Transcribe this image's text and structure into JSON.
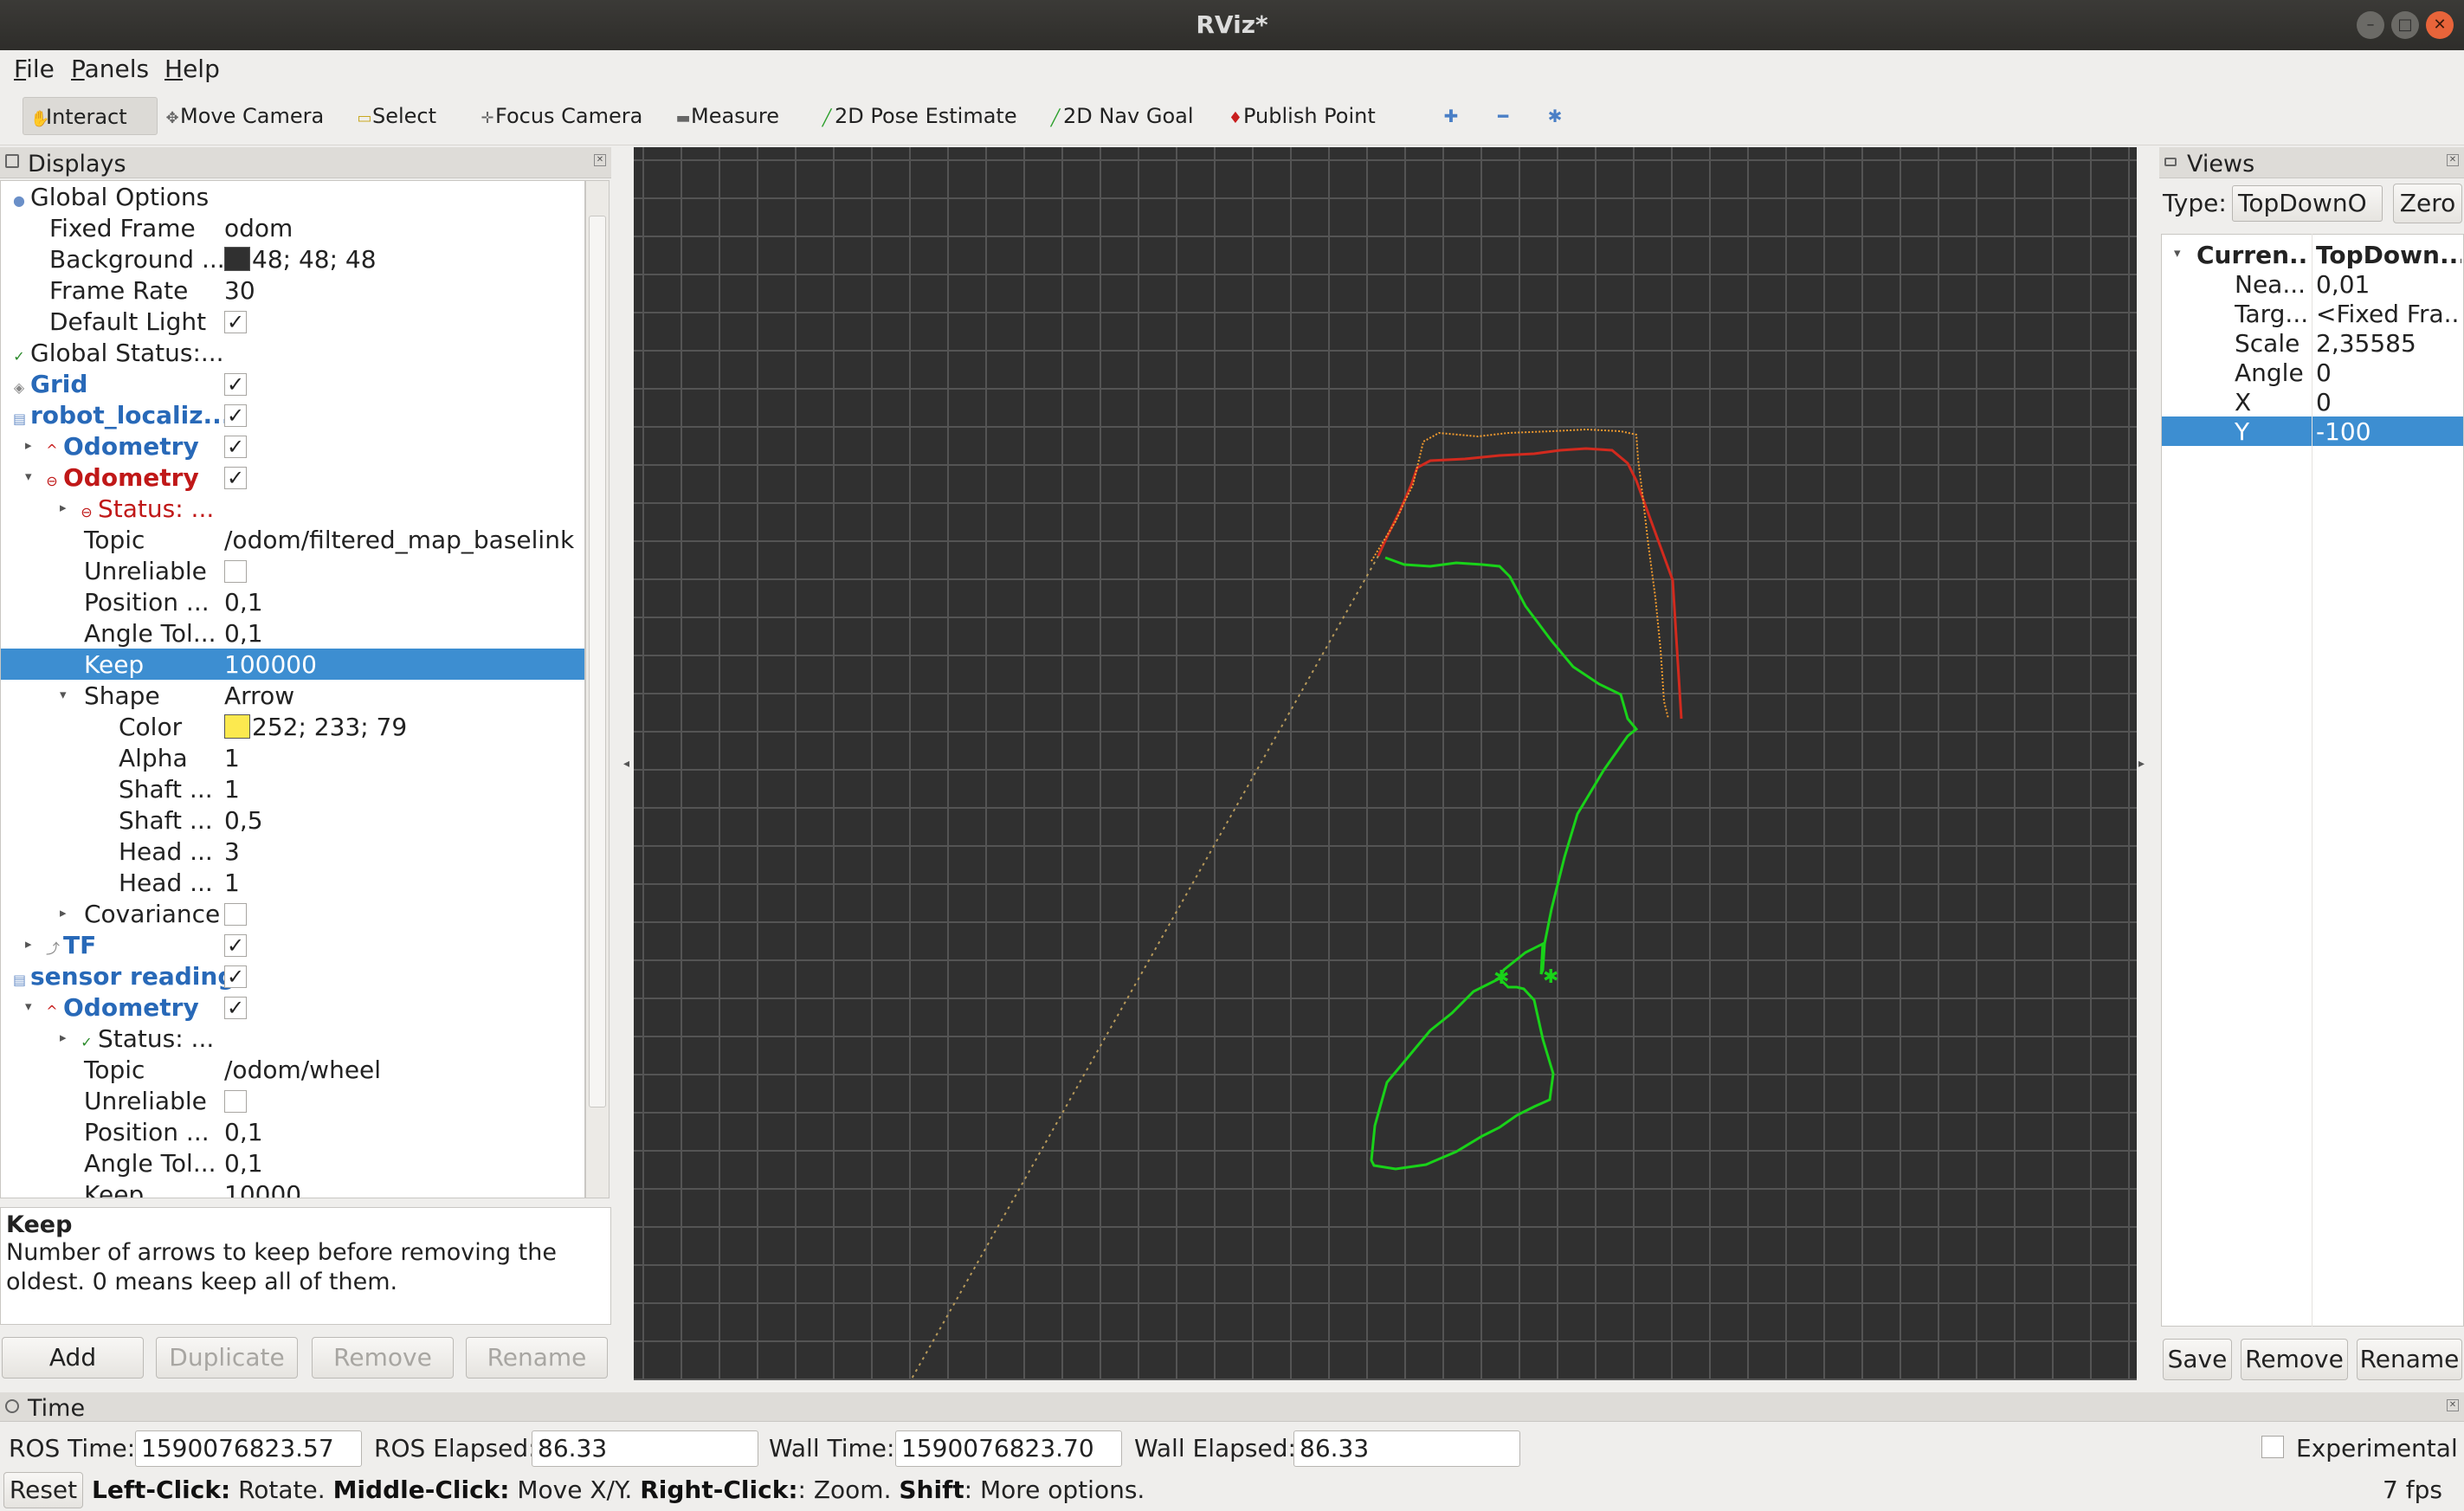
{
  "window": {
    "title": "RViz*"
  },
  "menu": [
    "File",
    "Panels",
    "Help"
  ],
  "toolbar": {
    "interact": "Interact",
    "move_camera": "Move Camera",
    "select": "Select",
    "focus_camera": "Focus Camera",
    "measure": "Measure",
    "pose_estimate": "2D Pose Estimate",
    "nav_goal": "2D Nav Goal",
    "publish_point": "Publish Point"
  },
  "displays": {
    "title": "Displays",
    "rows": {
      "global_options": "Global Options",
      "fixed_frame": {
        "label": "Fixed Frame",
        "value": "odom"
      },
      "background": {
        "label": "Background ...",
        "value": "48; 48; 48",
        "color": "#303030"
      },
      "frame_rate": {
        "label": "Frame Rate",
        "value": "30"
      },
      "default_light": {
        "label": "Default Light"
      },
      "global_status": "Global Status:...",
      "grid": "Grid",
      "robot_localization": "robot_localiz...",
      "odometry1": "Odometry",
      "odometry2": "Odometry",
      "status1": "Status: ...",
      "topic1": {
        "label": "Topic",
        "value": "/odom/filtered_map_baselink"
      },
      "unreliable1": "Unreliable",
      "position1": {
        "label": "Position ...",
        "value": "0,1"
      },
      "angle1": {
        "label": "Angle Tol...",
        "value": "0,1"
      },
      "keep1": {
        "label": "Keep",
        "value": "100000"
      },
      "shape": {
        "label": "Shape",
        "value": "Arrow"
      },
      "color": {
        "label": "Color",
        "value": "252; 233; 79",
        "color": "#fce94f"
      },
      "alpha": {
        "label": "Alpha",
        "value": "1"
      },
      "shaft1": {
        "label": "Shaft ...",
        "value": "1"
      },
      "shaft2": {
        "label": "Shaft ...",
        "value": "0,5"
      },
      "head1": {
        "label": "Head ...",
        "value": "3"
      },
      "head2": {
        "label": "Head ...",
        "value": "1"
      },
      "covariance": "Covariance",
      "tf": "TF",
      "sensor_reading": "sensor reading",
      "odometry3": "Odometry",
      "status2": "Status: ...",
      "topic2": {
        "label": "Topic",
        "value": "/odom/wheel"
      },
      "unreliable2": "Unreliable",
      "position2": {
        "label": "Position ...",
        "value": "0,1"
      },
      "angle2": {
        "label": "Angle Tol...",
        "value": "0,1"
      },
      "keep2": {
        "label": "Keep",
        "value": "10000"
      }
    },
    "description": {
      "title": "Keep",
      "text": "Number of arrows to keep before removing the oldest. 0 means keep all of them."
    },
    "buttons": {
      "add": "Add",
      "duplicate": "Duplicate",
      "remove": "Remove",
      "rename": "Rename"
    }
  },
  "views": {
    "title": "Views",
    "type_label": "Type:",
    "type_value": "TopDownO",
    "zero": "Zero",
    "rows": [
      {
        "a": "Curren...",
        "b": "TopDown..."
      },
      {
        "a": "Nea...",
        "b": "0,01"
      },
      {
        "a": "Targ...",
        "b": "<Fixed Fra..."
      },
      {
        "a": "Scale",
        "b": "2,35585"
      },
      {
        "a": "Angle",
        "b": "0"
      },
      {
        "a": "X",
        "b": "0"
      },
      {
        "a": "Y",
        "b": "-100"
      }
    ],
    "buttons": {
      "save": "Save",
      "remove": "Remove",
      "rename": "Rename"
    }
  },
  "time": {
    "title": "Time",
    "ros_time_label": "ROS Time:",
    "ros_time": "1590076823.57",
    "ros_elapsed_label": "ROS Elapsed:",
    "ros_elapsed": "86.33",
    "wall_time_label": "Wall Time:",
    "wall_time": "1590076823.70",
    "wall_elapsed_label": "Wall Elapsed:",
    "wall_elapsed": "86.33",
    "experimental": "Experimental",
    "reset": "Reset",
    "hint": {
      "left_key": "Left-Click:",
      "left_text": " Rotate. ",
      "middle_key": "Middle-Click:",
      "middle_text": " Move X/Y. ",
      "right_key": "Right-Click:",
      "right_text": ": Zoom. ",
      "shift_key": "Shift",
      "shift_text": ": More options."
    },
    "fps": "7 fps"
  },
  "colors": {
    "selection": "#3d8ed1",
    "grid_background": "#303030",
    "path_green": "#19d219",
    "path_red": "#d22a1e",
    "path_orange": "#f09a2e"
  }
}
